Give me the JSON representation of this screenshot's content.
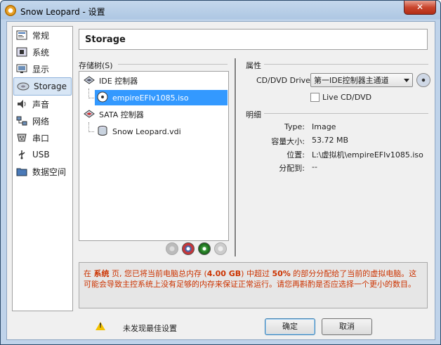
{
  "window": {
    "title": "Snow Leopard - 设置",
    "close_label": "✕"
  },
  "sidebar": {
    "items": [
      {
        "label": "常规",
        "icon": "general-icon"
      },
      {
        "label": "系统",
        "icon": "system-chip-icon"
      },
      {
        "label": "显示",
        "icon": "display-monitor-icon"
      },
      {
        "label": "Storage",
        "icon": "storage-disk-icon",
        "selected": true
      },
      {
        "label": "声音",
        "icon": "audio-speaker-icon"
      },
      {
        "label": "网络",
        "icon": "network-icon"
      },
      {
        "label": "串口",
        "icon": "serial-port-icon"
      },
      {
        "label": "USB",
        "icon": "usb-icon"
      },
      {
        "label": "数据空间",
        "icon": "shared-folder-icon"
      }
    ]
  },
  "header": {
    "title": "Storage"
  },
  "storage_tree": {
    "label": "存储树(S)",
    "controllers": [
      {
        "name": "IDE 控制器",
        "icon": "ide-controller-icon",
        "attachments": [
          {
            "name": "empireEFIv1085.iso",
            "icon": "cd-disc-icon",
            "selected": true
          }
        ]
      },
      {
        "name": "SATA 控制器",
        "icon": "sata-controller-icon",
        "attachments": [
          {
            "name": "Snow Leopard.vdi",
            "icon": "hard-disk-icon"
          }
        ]
      }
    ]
  },
  "attributes": {
    "section_label": "属性",
    "drive_label": "CD/DVD Drive:",
    "drive_value": "第一IDE控制器主通道",
    "live_cd_label": "Live CD/DVD",
    "live_cd_checked": false
  },
  "details": {
    "section_label": "明细",
    "rows": [
      {
        "key": "Type:",
        "value": "Image"
      },
      {
        "key": "容量大小:",
        "value": "53.72 MB"
      },
      {
        "key": "位置:",
        "value": "L:\\虚拟机\\empireEFIv1085.iso"
      },
      {
        "key": "分配到:",
        "value": "--"
      }
    ]
  },
  "warning": {
    "part1": "在 ",
    "page": "系统",
    "part2": " 页, 您已将当前电脑总内存 (",
    "memory": "4.00 GB",
    "part3": ") 中超过 ",
    "percent": "50%",
    "part4": " 的部分分配给了当前的虚拟电脑。这可能会导致主控系统上没有足够的内存来保证正常运行。请您再斟酌是否应选择一个更小的数目。"
  },
  "footer": {
    "status_text": "未发现最佳设置",
    "ok_label": "确定",
    "cancel_label": "取消"
  },
  "colors": {
    "accent": "#3399ff",
    "warning_text": "#cc3300",
    "title_bar": "#aec7e3"
  }
}
